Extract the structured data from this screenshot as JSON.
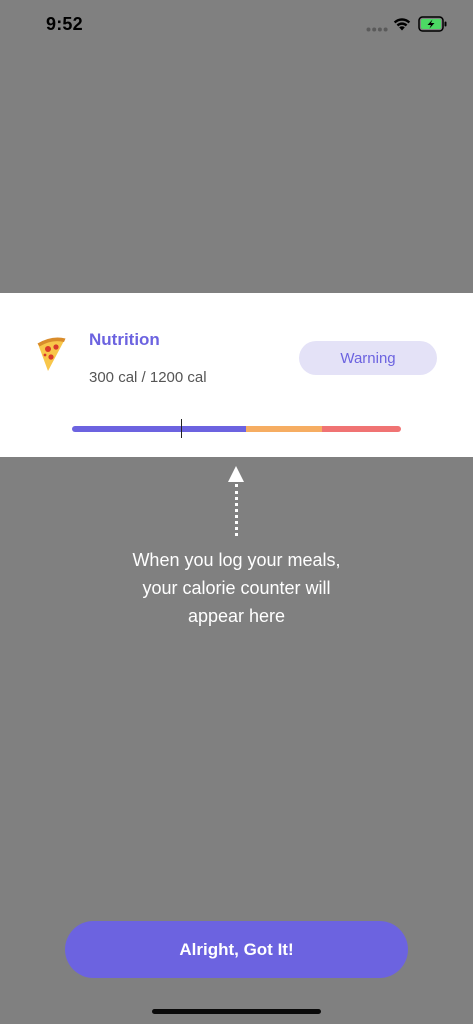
{
  "status_bar": {
    "time": "9:52",
    "icons": [
      "cellular-dots-icon",
      "wifi-icon",
      "battery-charging-icon"
    ],
    "battery_color": "#4cd964"
  },
  "card": {
    "icon": "pizza-icon",
    "title": "Nutrition",
    "subtitle": "300 cal / 1200 cal",
    "badge": "Warning",
    "progress": {
      "consumed": 300,
      "goal": 1200,
      "segments": [
        {
          "name": "ok",
          "color": "#6c63e0",
          "fraction": 0.53
        },
        {
          "name": "warning",
          "color": "#f6ad62",
          "fraction": 0.23
        },
        {
          "name": "over",
          "color": "#f07373",
          "fraction": 0.24
        }
      ],
      "marker_fraction": 0.33
    }
  },
  "tip": {
    "icon": "up-arrow-icon",
    "lines": [
      "When you log your meals,",
      "your calorie counter will",
      "appear here"
    ]
  },
  "primary_button": {
    "label": "Alright, Got It!"
  },
  "colors": {
    "accent": "#6c63e0",
    "overlay": "#808080",
    "badge_bg": "#e4e2f7"
  }
}
